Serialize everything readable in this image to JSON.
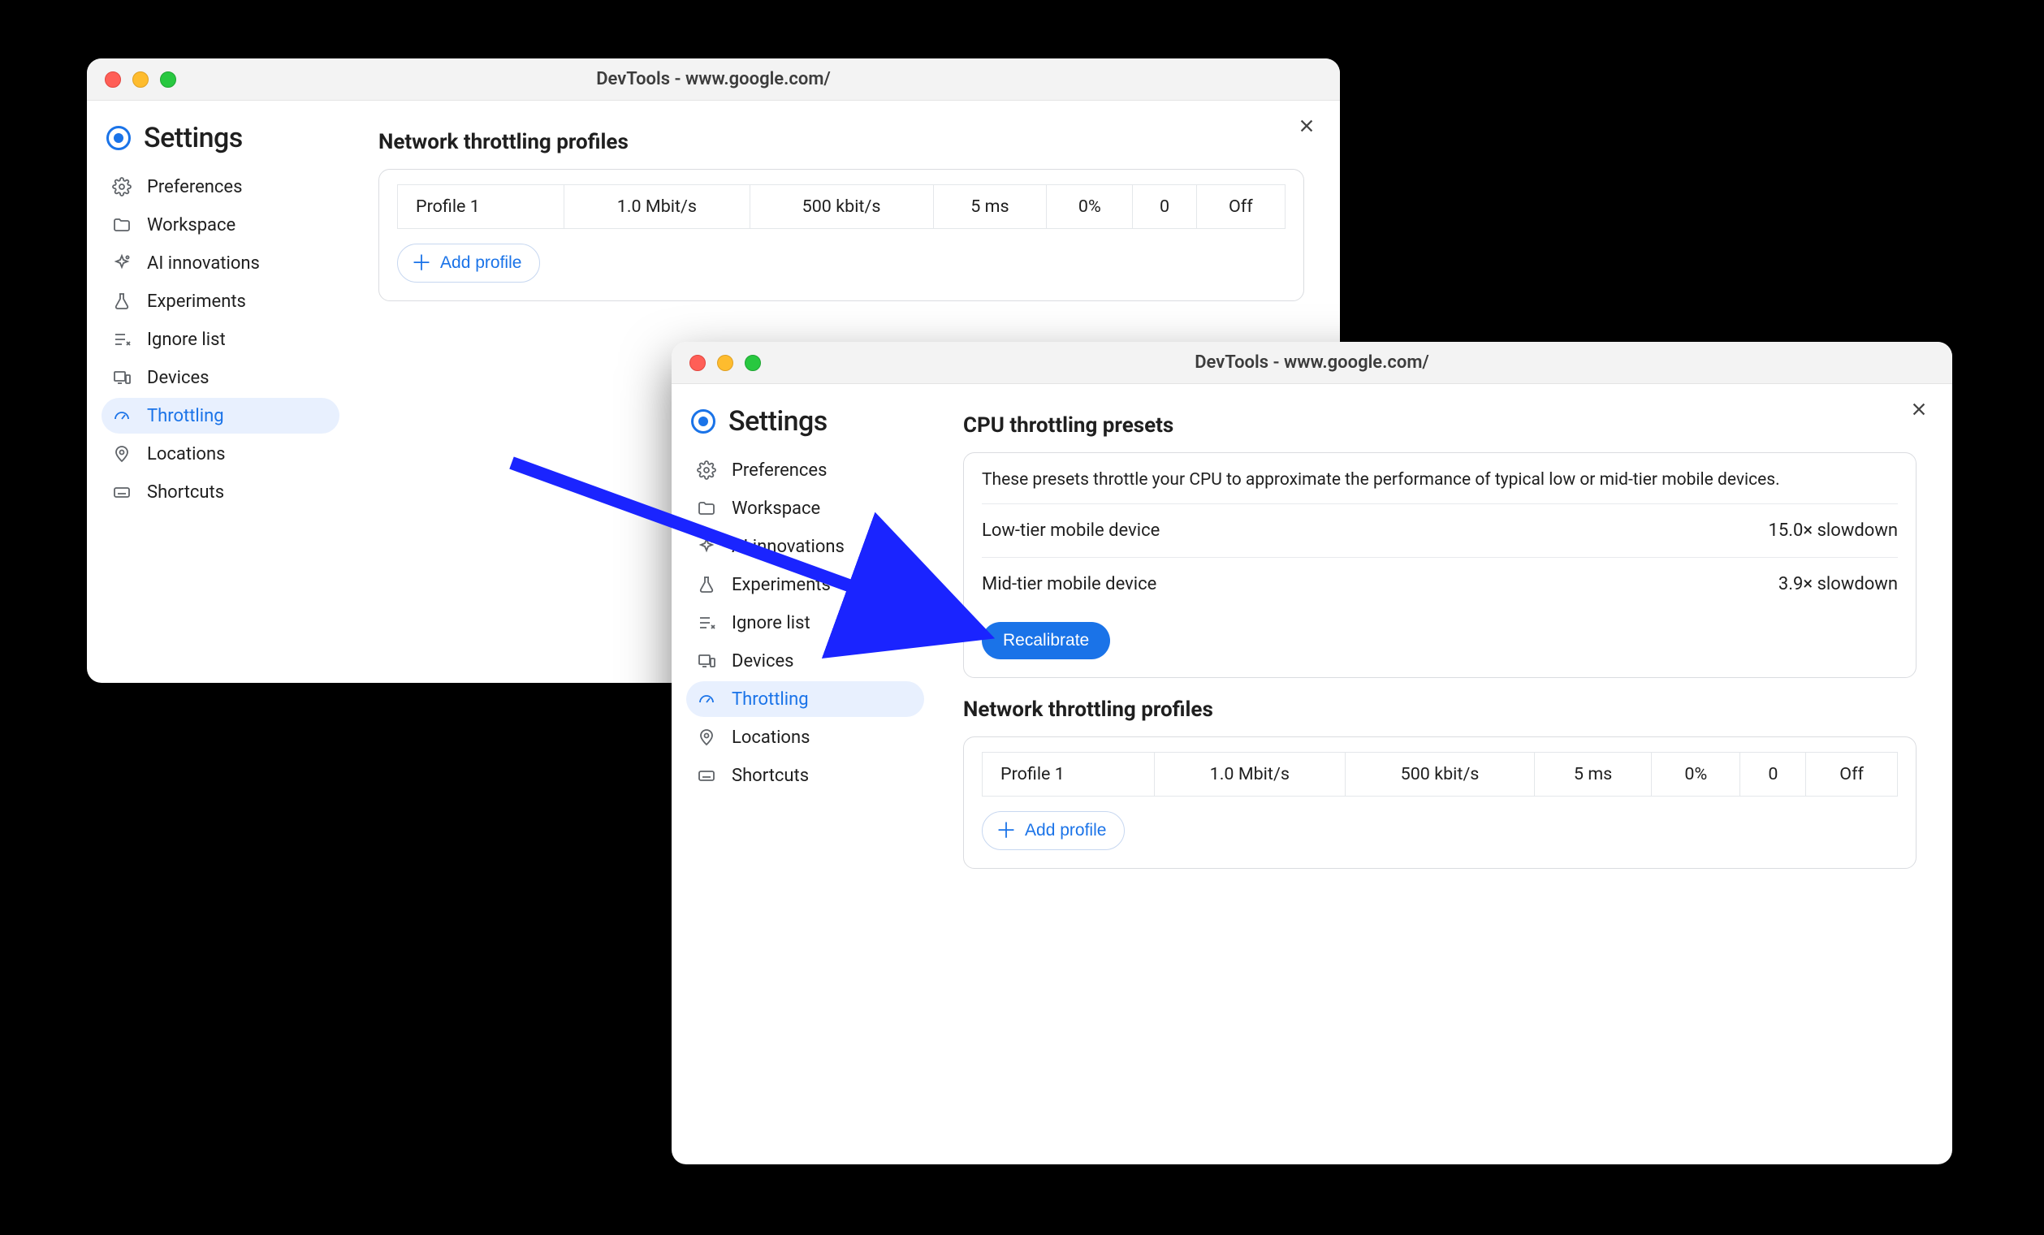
{
  "win1": {
    "title": "DevTools - www.google.com/",
    "settings_heading": "Settings",
    "nav": [
      {
        "label": "Preferences"
      },
      {
        "label": "Workspace"
      },
      {
        "label": "AI innovations"
      },
      {
        "label": "Experiments"
      },
      {
        "label": "Ignore list"
      },
      {
        "label": "Devices"
      },
      {
        "label": "Throttling"
      },
      {
        "label": "Locations"
      },
      {
        "label": "Shortcuts"
      }
    ],
    "section_heading": "Network throttling profiles",
    "profile_row": [
      "Profile 1",
      "1.0 Mbit/s",
      "500 kbit/s",
      "5 ms",
      "0%",
      "0",
      "Off"
    ],
    "add_profile": "Add profile"
  },
  "win2": {
    "title": "DevTools - www.google.com/",
    "settings_heading": "Settings",
    "nav": [
      {
        "label": "Preferences"
      },
      {
        "label": "Workspace"
      },
      {
        "label": "AI innovations"
      },
      {
        "label": "Experiments"
      },
      {
        "label": "Ignore list"
      },
      {
        "label": "Devices"
      },
      {
        "label": "Throttling"
      },
      {
        "label": "Locations"
      },
      {
        "label": "Shortcuts"
      }
    ],
    "cpu_heading": "CPU throttling presets",
    "cpu_desc": "These presets throttle your CPU to approximate the performance of typical low or mid-tier mobile devices.",
    "presets": [
      {
        "name": "Low-tier mobile device",
        "value": "15.0× slowdown"
      },
      {
        "name": "Mid-tier mobile device",
        "value": "3.9× slowdown"
      }
    ],
    "recalibrate": "Recalibrate",
    "net_heading": "Network throttling profiles",
    "profile_row": [
      "Profile 1",
      "1.0 Mbit/s",
      "500 kbit/s",
      "5 ms",
      "0%",
      "0",
      "Off"
    ],
    "add_profile": "Add profile"
  }
}
